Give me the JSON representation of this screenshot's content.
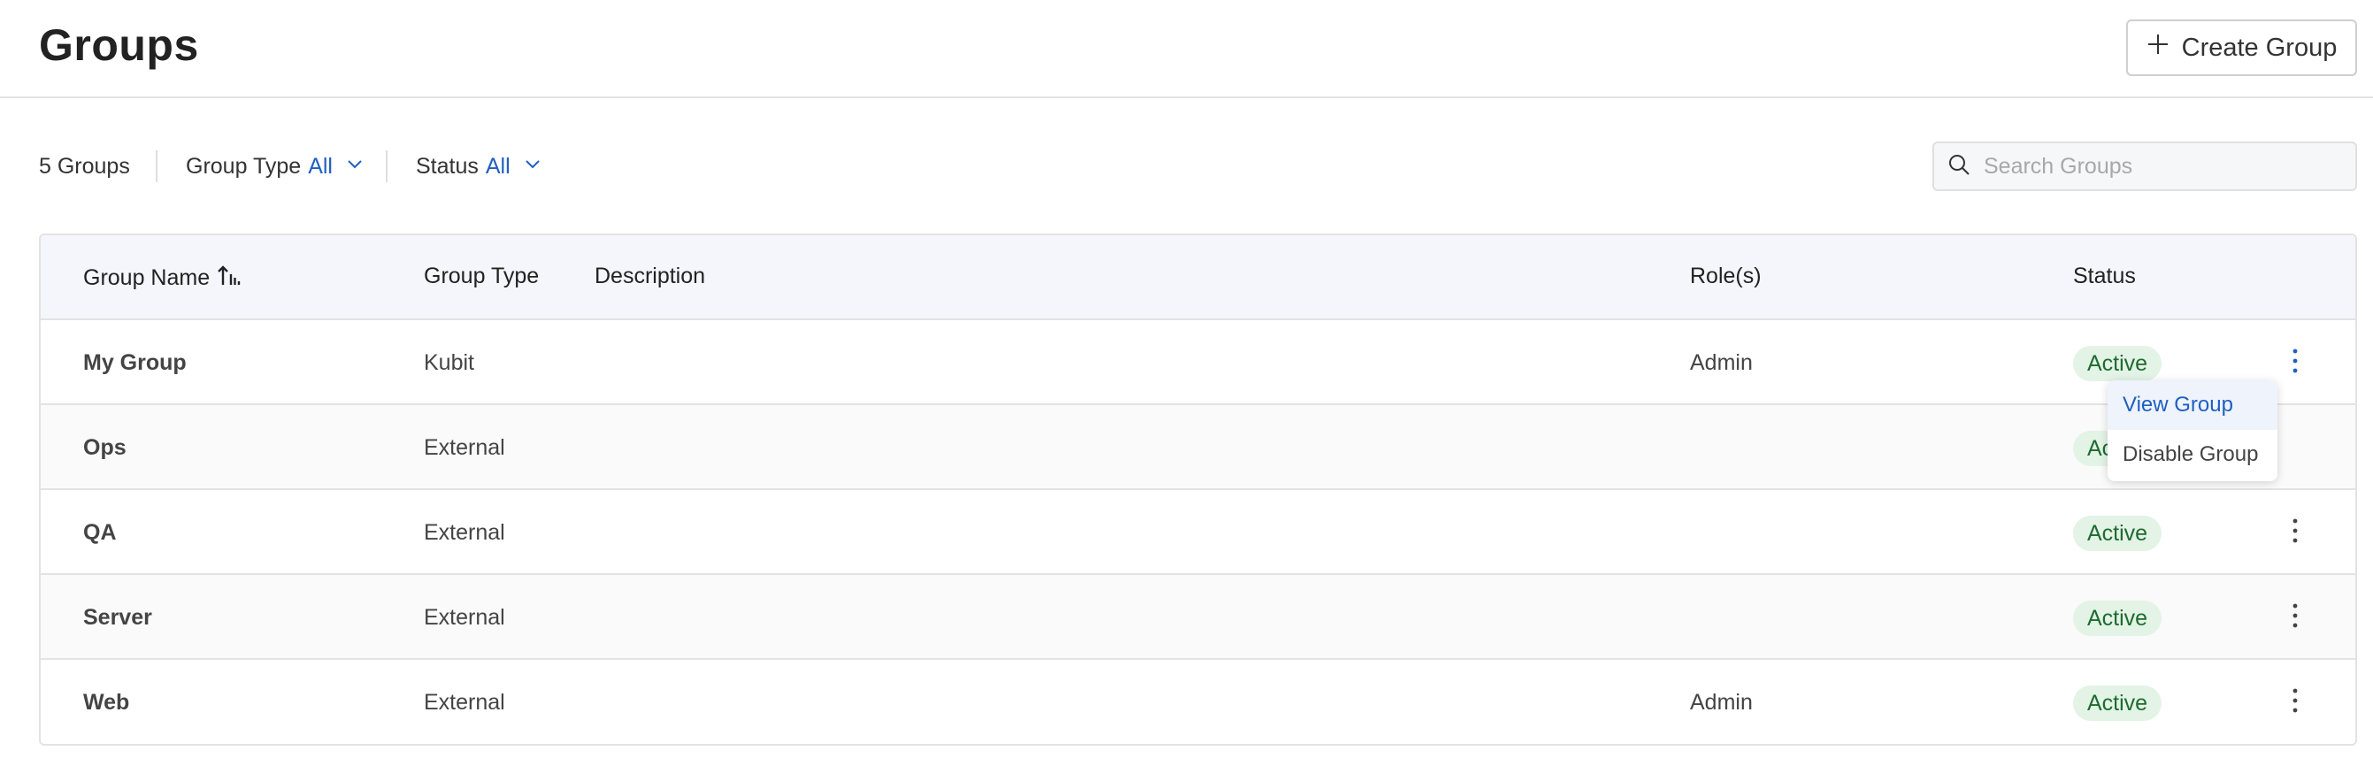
{
  "header": {
    "title": "Groups",
    "create_label": "Create Group"
  },
  "toolbar": {
    "count": "5 Groups",
    "filters": [
      {
        "label": "Group Type",
        "value": "All"
      },
      {
        "label": "Status",
        "value": "All"
      }
    ],
    "search_placeholder": "Search Groups"
  },
  "table": {
    "columns": [
      "Group Name",
      "Group Type",
      "Description",
      "Role(s)",
      "Status"
    ],
    "rows": [
      {
        "name": "My Group",
        "type": "Kubit",
        "description": "",
        "roles": "Admin",
        "status": "Active"
      },
      {
        "name": "Ops",
        "type": "External",
        "description": "",
        "roles": "",
        "status": "Active"
      },
      {
        "name": "QA",
        "type": "External",
        "description": "",
        "roles": "",
        "status": "Active"
      },
      {
        "name": "Server",
        "type": "External",
        "description": "",
        "roles": "",
        "status": "Active"
      },
      {
        "name": "Web",
        "type": "External",
        "description": "",
        "roles": "Admin",
        "status": "Active"
      }
    ]
  },
  "row_menu": {
    "items": [
      "View Group",
      "Disable Group"
    ],
    "highlighted": "View Group"
  },
  "colors": {
    "accent": "#1f5fbf",
    "status_bg": "#e3f3e6",
    "status_text": "#1e6b2f",
    "header_bg": "#f4f6fb"
  },
  "icons": {
    "create": "plus-icon",
    "filter_dropdown": "chevron-down-icon",
    "search": "search-icon",
    "sort": "sort-icon",
    "row_actions": "kebab-menu-icon"
  }
}
